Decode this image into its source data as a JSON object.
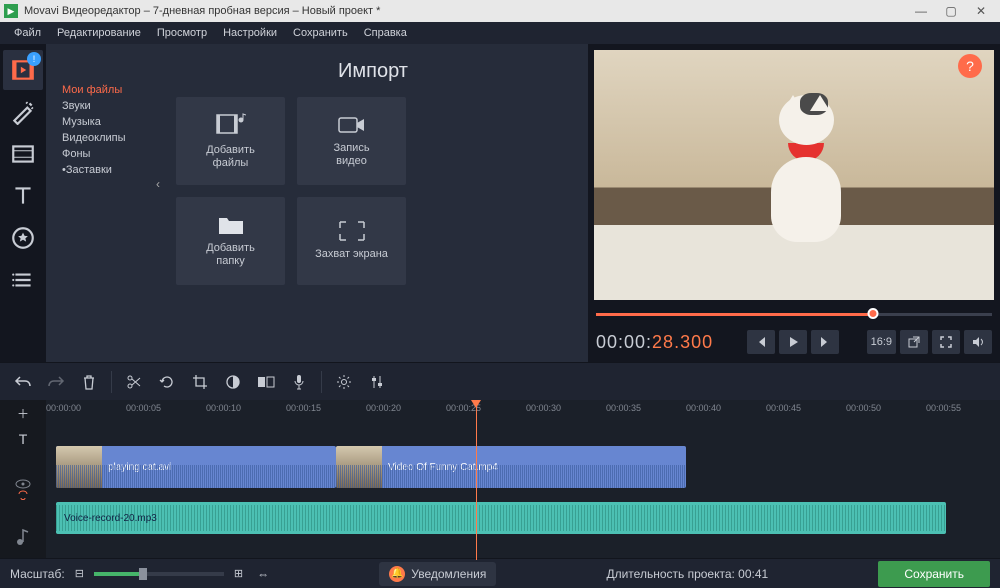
{
  "titlebar": {
    "title": "Movavi Видеоредактор – 7-дневная пробная версия – Новый проект *"
  },
  "menu": [
    "Файл",
    "Редактирование",
    "Просмотр",
    "Настройки",
    "Сохранить",
    "Справка"
  ],
  "sidebar": {
    "notif": "!"
  },
  "import": {
    "title": "Импорт",
    "items": [
      "Мои файлы",
      "Звуки",
      "Музыка",
      "Видеоклипы",
      "Фоны",
      "•Заставки"
    ],
    "tiles": {
      "add_files": "Добавить\nфайлы",
      "record_video": "Запись\nвидео",
      "add_folder": "Добавить\nпапку",
      "capture": "Захват экрана"
    }
  },
  "preview": {
    "timecode_grey": "00:00:",
    "timecode_orange": "28.300",
    "ratio": "16:9"
  },
  "ruler": [
    "00:00:00",
    "00:00:05",
    "00:00:10",
    "00:00:15",
    "00:00:20",
    "00:00:25",
    "00:00:30",
    "00:00:35",
    "00:00:40",
    "00:00:45",
    "00:00:50",
    "00:00:55"
  ],
  "clips": {
    "v1": "playing cat.avi",
    "v2": "Video Of Funny Cat.mp4",
    "a1": "Voice-record-20.mp3"
  },
  "bottom": {
    "zoom_label": "Масштаб:",
    "notif": "Уведомления",
    "duration": "Длительность проекта:  00:41",
    "save": "Сохранить"
  },
  "help": "?"
}
